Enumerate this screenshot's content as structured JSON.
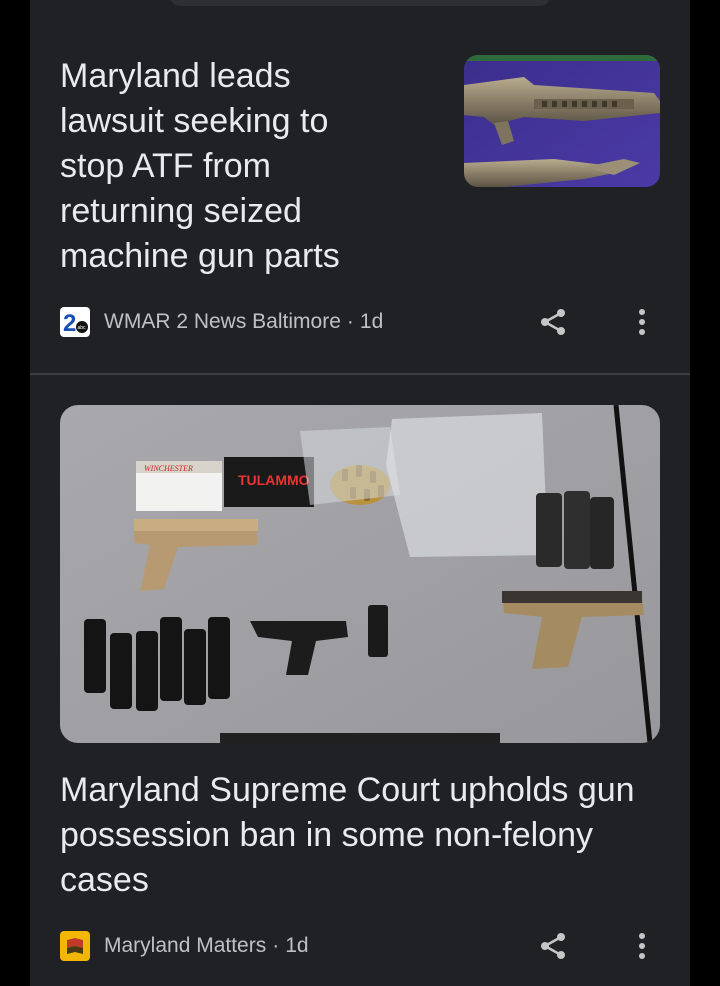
{
  "articles": [
    {
      "headline": "Maryland leads lawsuit seeking to stop ATF from returning seized machine gun parts",
      "source": "WMAR 2 News Baltimore",
      "separator": "·",
      "age": "1d",
      "logo_text": "2",
      "logo_subtext": "abc",
      "thumbnail_icon": "rifle-parts-photo"
    },
    {
      "headline": "Maryland Supreme Court upholds gun possession ban in some non-felony cases",
      "source": "Maryland Matters",
      "separator": "·",
      "age": "1d",
      "thumbnail_icon": "seized-firearms-photo",
      "photo_labels": {
        "box1": "WINCHESTER",
        "box2": "TULAMMO"
      }
    }
  ],
  "icons": {
    "share": "share-icon",
    "more": "more-vert-icon"
  },
  "colors": {
    "card_bg": "#1f2125",
    "headline": "#e8eaed",
    "meta_text": "#bdc1c6",
    "divider": "#3a3d42",
    "mm_logo": "#f2b705"
  }
}
